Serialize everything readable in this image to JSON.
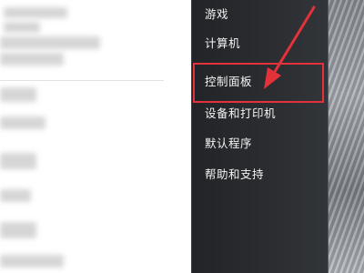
{
  "menu": {
    "items": [
      {
        "label": "游戏"
      },
      {
        "label": "计算机"
      },
      {
        "label": "控制面板"
      },
      {
        "label": "设备和打印机"
      },
      {
        "label": "默认程序"
      },
      {
        "label": "帮助和支持"
      }
    ]
  },
  "annotation": {
    "highlight_color": "#e5323a",
    "arrow_color": "#e5323a"
  },
  "icons": {
    "arrow": "arrow-icon"
  }
}
